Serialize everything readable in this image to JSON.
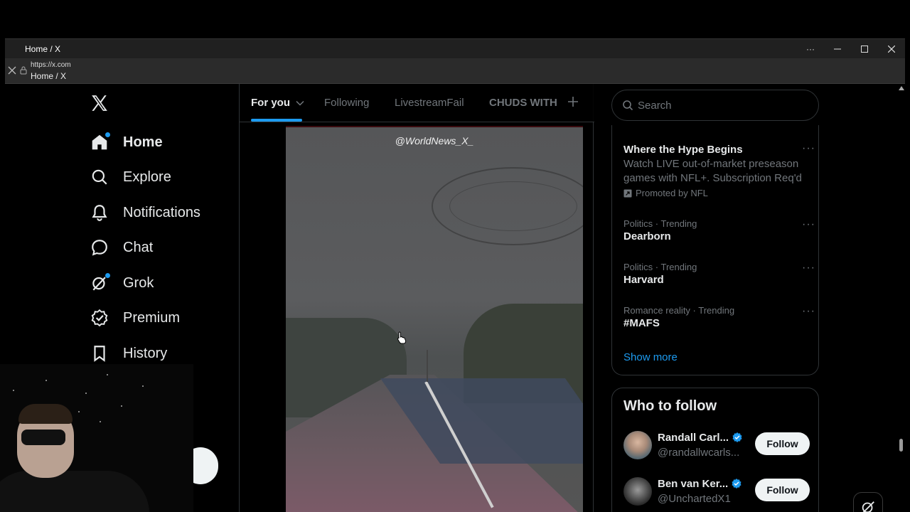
{
  "window": {
    "title": "Home / X",
    "url": "https://x.com",
    "tab_title": "Home / X"
  },
  "nav": {
    "items": [
      {
        "label": "Home",
        "icon": "home-icon"
      },
      {
        "label": "Explore",
        "icon": "search-icon"
      },
      {
        "label": "Notifications",
        "icon": "bell-icon"
      },
      {
        "label": "Chat",
        "icon": "chat-bubble-icon"
      },
      {
        "label": "Grok",
        "icon": "grok-icon"
      },
      {
        "label": "Premium",
        "icon": "verified-badge-icon"
      },
      {
        "label": "History",
        "icon": "bookmark-icon"
      }
    ]
  },
  "feed": {
    "tabs": [
      "For you",
      "Following",
      "LivestreamFail",
      "CHUDS WITH"
    ],
    "video_watermark": "@WorldNews_X_"
  },
  "search": {
    "placeholder": "Search"
  },
  "trends": {
    "promoted": {
      "title": "Where the Hype Begins",
      "desc": "Watch LIVE out-of-market preseason games with NFL+. Subscription Req'd",
      "promo": "Promoted by NFL"
    },
    "items": [
      {
        "meta": "Politics · Trending",
        "name": "Dearborn"
      },
      {
        "meta": "Politics · Trending",
        "name": "Harvard"
      },
      {
        "meta": "Romance reality · Trending",
        "name": "#MAFS"
      }
    ],
    "show_more": "Show more"
  },
  "who_to_follow": {
    "header": "Who to follow",
    "users": [
      {
        "name": "Randall Carl...",
        "handle": "@randallwcarls...",
        "button": "Follow"
      },
      {
        "name": "Ben van Ker...",
        "handle": "@UnchartedX1",
        "button": "Follow"
      }
    ]
  },
  "colors": {
    "accent": "#1d9bf0",
    "background": "#000000",
    "border": "#2f3336",
    "muted_text": "#71767b"
  }
}
